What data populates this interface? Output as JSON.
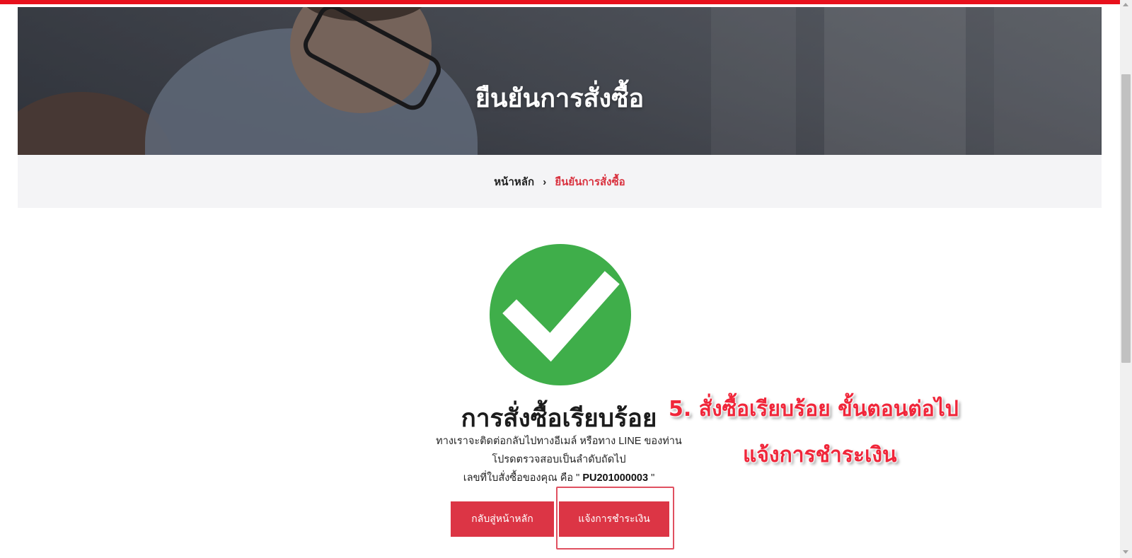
{
  "hero": {
    "title": "ยืนยันการสั่งซื้อ"
  },
  "breadcrumb": {
    "home": "หน้าหลัก",
    "separator": "›",
    "current": "ยืนยันการสั่งซื้อ"
  },
  "success": {
    "icon": "check-icon",
    "title": "การสั่งซื้อเรียบร้อย",
    "line1": "ทางเราจะติดต่อกลับไปทางอีเมล์ หรือทาง LINE ของท่าน",
    "line2": "โปรดตรวจสอบเป็นลำดับถัดไป",
    "line3_prefix": "เลขที่ใบสั่งซื้อของคุณ คือ \" ",
    "order_number": "PU201000003",
    "line3_suffix": " \""
  },
  "buttons": {
    "home": "กลับสู่หน้าหลัก",
    "payment": "แจ้งการชำระเงิน"
  },
  "annotation": {
    "line1": "5. สั่งซื้อเรียบร้อย ขั้นตอนต่อไป",
    "line2": "แจ้งการชำระเงิน"
  },
  "colors": {
    "accent": "#dc3545",
    "success": "#3fae4a",
    "annotation": "#f0263a",
    "top_bar": "#e8101c"
  }
}
